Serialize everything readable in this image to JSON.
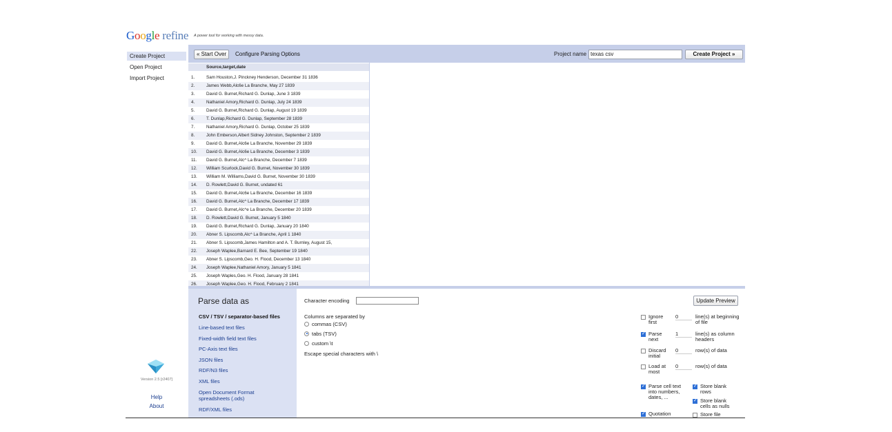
{
  "header": {
    "logo_google": "Google",
    "logo_refine": "refine",
    "tagline": "A power tool for working with messy data."
  },
  "nav": {
    "items": [
      "Create Project",
      "Open Project",
      "Import Project"
    ],
    "version": "Version 2.5 [r2407]",
    "help": "Help",
    "about": "About"
  },
  "toolbar": {
    "start_over": "« Start Over",
    "configure": "Configure Parsing Options",
    "project_name_label": "Project name",
    "project_name_value": "texas csv",
    "create_project": "Create Project »"
  },
  "preview": {
    "column_header": "Source,target,date",
    "rows": [
      {
        "n": "1.",
        "v": "Sam Houston,J. Pinckney Henderson, December 31 1836"
      },
      {
        "n": "2.",
        "v": "James Webb,Alc6e La Branche, May 27 1839"
      },
      {
        "n": "3.",
        "v": "David G. Burnet,Richard G. Dunlap, June 3 1839"
      },
      {
        "n": "4.",
        "v": "Nathaniel Amory,Richard G. Dunlap, July 24 1839"
      },
      {
        "n": "5.",
        "v": "David G. Burnet,Richard G. Dunlap, August 19 1839"
      },
      {
        "n": "6.",
        "v": "T. Dunlap,Richard G. Dunlap, September 28 1839"
      },
      {
        "n": "7.",
        "v": "Nathaniel Amory,Richard G. Dunlap, October 25 1839"
      },
      {
        "n": "8.",
        "v": "John Emberson,Albert Sidney Johnston, September 2 1839"
      },
      {
        "n": "9.",
        "v": "David G. Burnet,Alc6e La Branche, November 29 1839"
      },
      {
        "n": "10.",
        "v": "David G. Burnet,Alc6e La Branche, December 3 1839"
      },
      {
        "n": "11.",
        "v": "David G. Burnet,Alc^ La Branche, December 7 1839"
      },
      {
        "n": "12.",
        "v": "William Scurlock,David G. Burnet, November 30 1839"
      },
      {
        "n": "13.",
        "v": "William M. Williams,David G. Burnet, November 30 1839"
      },
      {
        "n": "14.",
        "v": "D. Rowlett,David G. Burnet, undated 61"
      },
      {
        "n": "15.",
        "v": "David G. Burnet,Alc6e La Branche, December 16 1839"
      },
      {
        "n": "16.",
        "v": "David G. Burnet,Alc^ La Branche, December 17 1839"
      },
      {
        "n": "17.",
        "v": "David G. Burnet,Alc^e La Branche, December 20 1839"
      },
      {
        "n": "18.",
        "v": "D. Rowlett,David G. Burnet, January 5 1840"
      },
      {
        "n": "19.",
        "v": "David G. Burnet,Richard G. Dunlap, January 20 1840"
      },
      {
        "n": "20.",
        "v": "Abner S. Lipscomb,Alc^ La Branche, April 1 1840"
      },
      {
        "n": "21.",
        "v": "Abner S. Lipscomb,James Hamilton and A. T. Burnley, August 15,"
      },
      {
        "n": "22.",
        "v": "Joseph Waplee,Barnard E. Bee, September 19 1840"
      },
      {
        "n": "23.",
        "v": "Abner S. Lipscomb,Geo. H. Flood, December 13 1840"
      },
      {
        "n": "24.",
        "v": "Joseph Waplee,Nathaniel Amory, January 5 1841"
      },
      {
        "n": "25.",
        "v": "Joseph Waples,Geo. H. Flood, January 28 1841"
      },
      {
        "n": "26.",
        "v": "Joseph Waplee,Geo. H. Flood, February 2 1841"
      }
    ]
  },
  "parse": {
    "title": "Parse data as",
    "formats": [
      "CSV / TSV / separator-based files",
      "Line-based text files",
      "Fixed-width field text files",
      "PC-Axis text files",
      "JSON files",
      "RDF/N3 files",
      "XML files",
      "Open Document Format spreadsheets (.ods)",
      "RDF/XML files"
    ],
    "encoding_label": "Character encoding",
    "encoding_value": "",
    "update_preview": "Update Preview",
    "separator_label": "Columns are separated by",
    "separators": [
      "commas (CSV)",
      "tabs (TSV)",
      "custom  \\t"
    ],
    "selected_separator": 1,
    "escape_label": "Escape special characters with \\",
    "options": {
      "ignore": {
        "label": "Ignore first",
        "value": "0",
        "suffix": "line(s) at beginning of file",
        "checked": false
      },
      "parse_next": {
        "label": "Parse next",
        "value": "1",
        "suffix": "line(s) as column headers",
        "checked": true
      },
      "discard": {
        "label": "Discard initial",
        "value": "0",
        "suffix": "row(s) of data",
        "checked": false
      },
      "load_at_most": {
        "label": "Load at most",
        "value": "0",
        "suffix": "row(s) of data",
        "checked": false
      },
      "parse_cell_text": {
        "label": "Parse cell text into numbers, dates, ...",
        "checked": true
      },
      "quotation": {
        "label": "Quotation",
        "checked": true
      },
      "store_blank_rows": {
        "label": "Store blank rows",
        "checked": true
      },
      "store_blank_cells": {
        "label": "Store blank cells as nulls",
        "checked": true
      },
      "store_file": {
        "label": "Store file",
        "checked": false
      }
    }
  }
}
